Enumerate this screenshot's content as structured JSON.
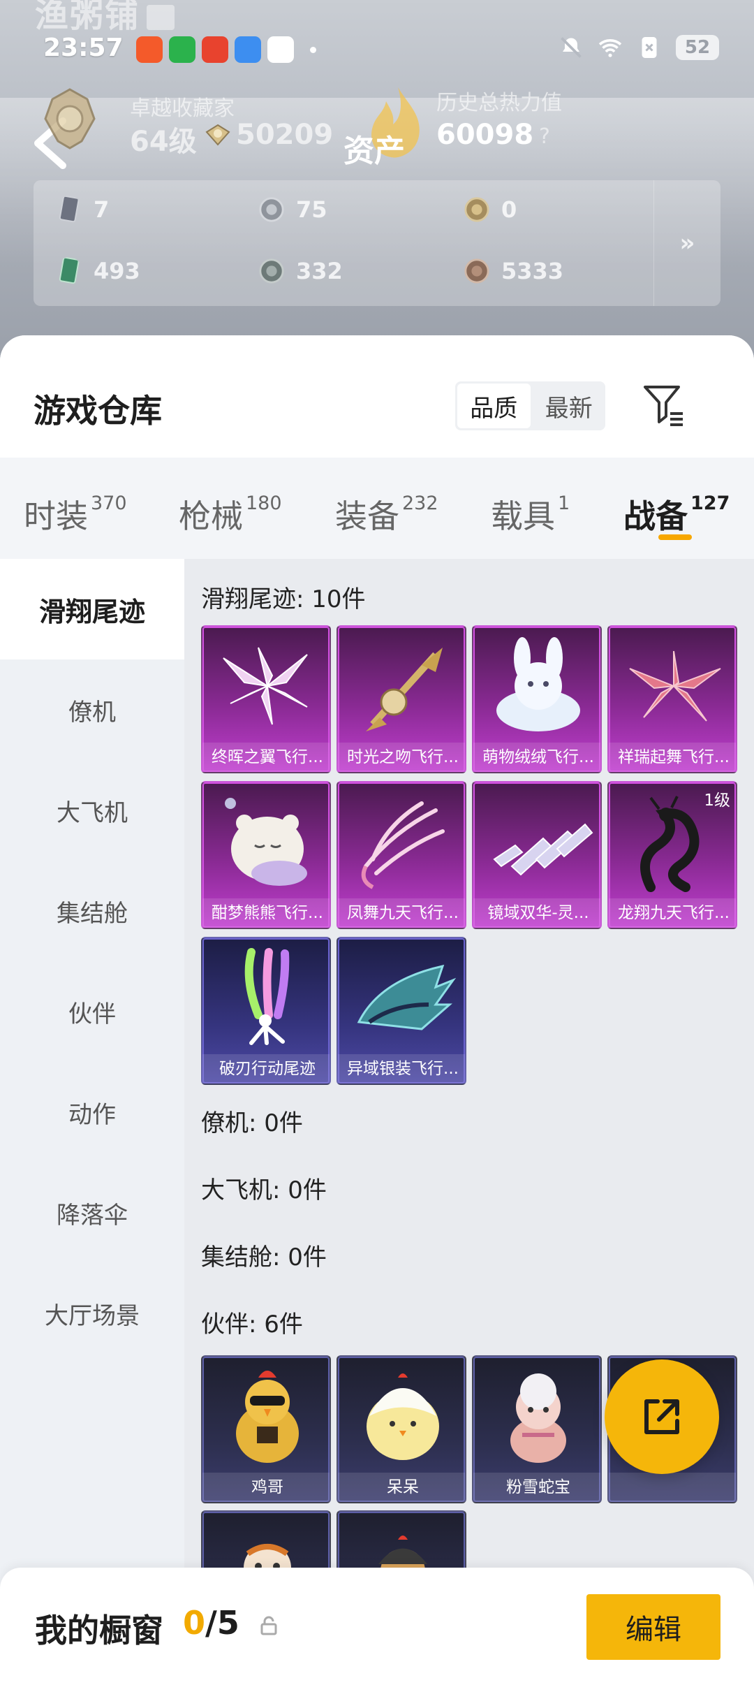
{
  "hero": {
    "bg_title": "渔粥铺",
    "status_time": "23:57",
    "battery": "52",
    "rank_title": "卓越收藏家",
    "rank_level": "64级",
    "rank_coins": "50209",
    "assets_label": "资产",
    "heat_label": "历史总热力值",
    "heat_value": "60098",
    "help": "?",
    "currencies": [
      {
        "icon": "card-icon",
        "value": "7"
      },
      {
        "icon": "silver-coin-icon",
        "value": "75"
      },
      {
        "icon": "gold-coin-icon",
        "value": "0"
      },
      {
        "icon": "ticket-icon",
        "value": "493"
      },
      {
        "icon": "gray-coin-icon",
        "value": "332"
      },
      {
        "icon": "bronze-coin-icon",
        "value": "5333"
      }
    ],
    "expand": "»"
  },
  "warehouse": {
    "title": "游戏仓库",
    "sort": [
      "品质",
      "最新"
    ]
  },
  "tabs": [
    {
      "label": "时装",
      "count": "370"
    },
    {
      "label": "枪械",
      "count": "180"
    },
    {
      "label": "装备",
      "count": "232"
    },
    {
      "label": "载具",
      "count": "1"
    },
    {
      "label": "战备",
      "count": "127"
    }
  ],
  "side": [
    "滑翔尾迹",
    "僚机",
    "大飞机",
    "集结舱",
    "伙伴",
    "动作",
    "降落伞",
    "大厅场景"
  ],
  "sections": {
    "trail": "滑翔尾迹: 10件",
    "wingman": "僚机: 0件",
    "plane": "大飞机: 0件",
    "capsule": "集结舱: 0件",
    "partner": "伙伴: 6件"
  },
  "trail_items": [
    {
      "name": "终晖之翼飞行...",
      "tier": "purple",
      "icon": "pink-wings-icon"
    },
    {
      "name": "时光之吻飞行...",
      "tier": "purple",
      "icon": "golden-scepter-icon"
    },
    {
      "name": "萌物绒绒飞行...",
      "tier": "purple",
      "icon": "white-bunny-icon"
    },
    {
      "name": "祥瑞起舞飞行...",
      "tier": "purple",
      "icon": "red-wings-icon"
    },
    {
      "name": "酣梦熊熊飞行...",
      "tier": "purple",
      "icon": "sleeping-bear-icon"
    },
    {
      "name": "凤舞九天飞行...",
      "tier": "purple",
      "icon": "phoenix-feather-icon"
    },
    {
      "name": "镜域双华-灵...",
      "tier": "purple",
      "icon": "crystal-shards-icon"
    },
    {
      "name": "龙翔九天飞行...",
      "tier": "purple",
      "icon": "black-dragon-icon",
      "level": "1级"
    },
    {
      "name": "破刃行动尾迹",
      "tier": "blue",
      "icon": "smoke-skydiver-icon"
    },
    {
      "name": "异域银装飞行...",
      "tier": "blue",
      "icon": "teal-armor-wing-icon"
    }
  ],
  "partner_items": [
    {
      "name": "鸡哥",
      "icon": "chicken-icon"
    },
    {
      "name": "呆呆",
      "icon": "chick-icon"
    },
    {
      "name": "粉雪蛇宝",
      "icon": "pink-snake-icon"
    },
    {
      "name": "",
      "icon": "pink-creature-icon"
    }
  ],
  "bottom": {
    "title": "我的橱窗",
    "current": "0",
    "sep_total": "/5",
    "edit": "编辑"
  }
}
